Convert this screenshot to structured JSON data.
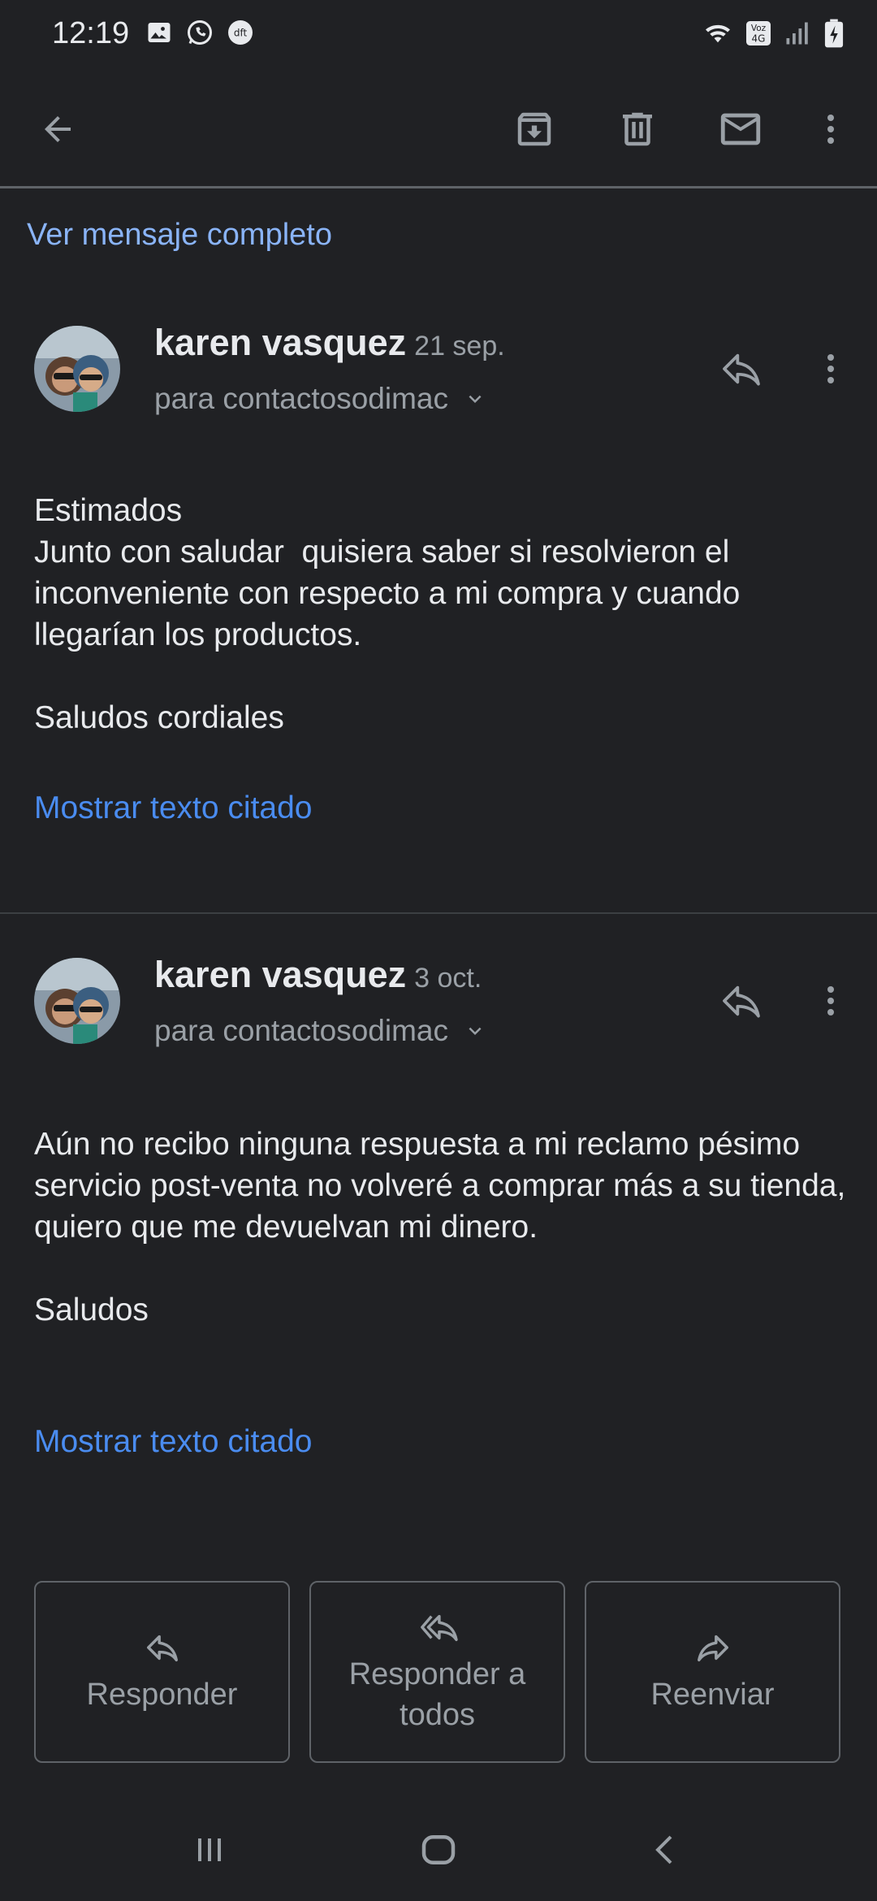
{
  "status_bar": {
    "time": "12:19",
    "left_icons": [
      "image-icon",
      "whatsapp-icon",
      "dft-icon"
    ],
    "right_icons": [
      "wifi-icon",
      "volte-4g-icon",
      "signal-icon",
      "battery-charging-icon"
    ],
    "dft_label": "dft",
    "volte_label": "Voz 4G"
  },
  "app_bar": {
    "icons": [
      "back-arrow-icon",
      "archive-icon",
      "delete-icon",
      "mark-unread-icon",
      "more-vert-icon"
    ]
  },
  "view_full_message": "Ver mensaje completo",
  "messages": [
    {
      "sender": "karen vasquez",
      "date": "21 sep.",
      "recipient": "para contactosodimac",
      "body": [
        "Estimados",
        "Junto con saludar  quisiera saber si resolvieron el inconveniente con respecto a mi compra y cuando llegarían los productos.",
        "",
        "Saludos cordiales"
      ],
      "quoted_link": "Mostrar texto citado"
    },
    {
      "sender": "karen vasquez",
      "date": "3 oct.",
      "recipient": "para contactosodimac",
      "body": [
        "Aún no recibo ninguna respuesta a mi reclamo pésimo servicio post-venta no volveré a comprar más a su tienda, quiero que me devuelvan mi dinero.",
        "",
        "Saludos"
      ],
      "quoted_link": "Mostrar texto citado"
    }
  ],
  "actions": {
    "reply": "Responder",
    "reply_all_line1": "Responder a",
    "reply_all_line2": "todos",
    "forward": "Reenviar"
  },
  "nav_bar": {
    "icons": [
      "recents-icon",
      "home-icon",
      "back-icon"
    ]
  },
  "colors": {
    "background": "#202124",
    "link": "#8ab4f8",
    "quoted_link": "#4a8cf0",
    "text": "#e8eaed",
    "secondary_text": "#9aa0a6"
  }
}
